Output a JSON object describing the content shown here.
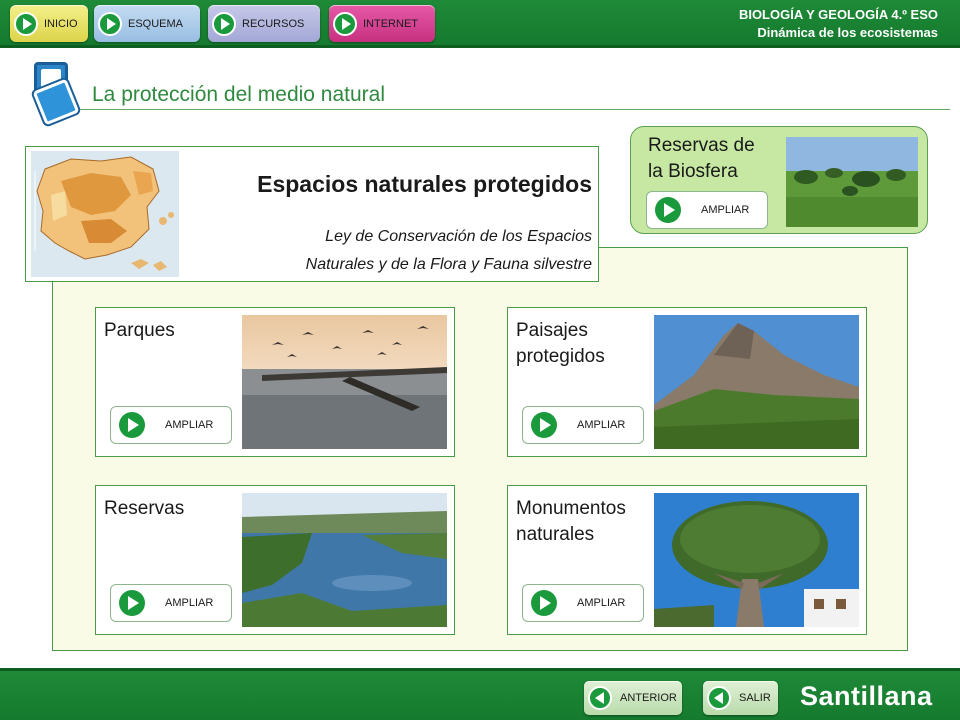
{
  "nav": {
    "inicio": "INICIO",
    "esquema": "ESQUEMA",
    "recursos": "RECURSOS",
    "internet": "INTERNET"
  },
  "course": {
    "subject": "BIOLOGÍA Y GEOLOGÍA 4.º ESO",
    "unit": "Dinámica de los ecosistemas"
  },
  "section": {
    "title": "La protección del medio natural"
  },
  "header": {
    "title": "Espacios naturales protegidos",
    "law_line1": "Ley de Conservación de los Espacios",
    "law_line2": "Naturales y de la Flora y Fauna silvestre"
  },
  "biosphere": {
    "title_line1": "Reservas de",
    "title_line2": "la Biosfera",
    "button": "AMPLIAR"
  },
  "cards": [
    {
      "title_line1": "Parques",
      "title_line2": "",
      "button": "AMPLIAR"
    },
    {
      "title_line1": "Paisajes",
      "title_line2": "protegidos",
      "button": "AMPLIAR"
    },
    {
      "title_line1": "Reservas",
      "title_line2": "",
      "button": "AMPLIAR"
    },
    {
      "title_line1": "Monumentos",
      "title_line2": "naturales",
      "button": "AMPLIAR"
    }
  ],
  "footer": {
    "anterior": "ANTERIOR",
    "salir": "SALIR",
    "brand": "Santillana"
  },
  "colors": {
    "bar_green": "#1f8a38",
    "title_green": "#2f8a3f",
    "panel_bg": "#fafbe6",
    "biosphere_bg": "#c6e8a2",
    "internet_pink": "#e55aa8"
  }
}
